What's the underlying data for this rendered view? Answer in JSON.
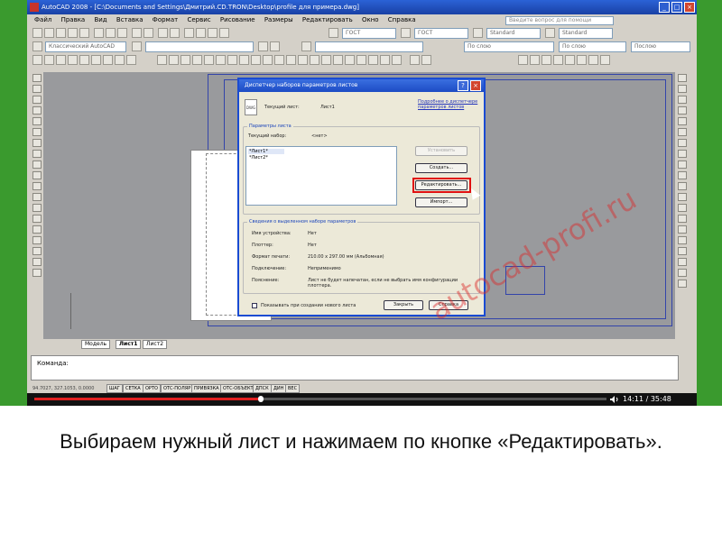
{
  "window": {
    "title": "AutoCAD 2008 - [C:\\Documents and Settings\\Дмитрий.CD.TRON\\Desktop\\profile для примера.dwg]",
    "help_placeholder": "Введите вопрос для помощи"
  },
  "menu": [
    "Файл",
    "Правка",
    "Вид",
    "Вставка",
    "Формат",
    "Сервис",
    "Рисование",
    "Размеры",
    "Редактировать",
    "Окно",
    "Справка"
  ],
  "toolbar": {
    "layer_select": "Классический AutoCAD",
    "style1": "ГОСТ",
    "style2": "ГОСТ",
    "style3": "Standard",
    "style4": "Standard",
    "linetype": "По слою",
    "lineweight": "По слою",
    "plotstyle": "Послою"
  },
  "tabs": [
    "Модель",
    "Лист1",
    "Лист2"
  ],
  "command": {
    "prompt": "Команда:"
  },
  "status": {
    "coords": "94.7027, 327.1053, 0.0000",
    "buttons": [
      "ШАГ",
      "СЕТКА",
      "ОРТО",
      "ОТС-ПОЛЯР",
      "ПРИВЯЗКА",
      "ОТС-ОБЪЕКТ",
      "ДПСК",
      "ДИН",
      "ВЕС"
    ]
  },
  "player": {
    "time": "14:11 / 35:48",
    "progress": 0.396
  },
  "dialog": {
    "title": "Диспетчер наборов параметров листов",
    "current_sheet_label": "Текущий лист:",
    "current_sheet_value": "Лист1",
    "help_link": "Подробнее о диспетчере параметров листов",
    "params_group": "Параметры листа",
    "current_set_label": "Текущий набор:",
    "current_set_value": "<нет>",
    "list_items": [
      "*Лист1*",
      "*Лист2*"
    ],
    "btn_set": "Установить",
    "btn_create": "Создать...",
    "btn_edit": "Редактировать...",
    "btn_import": "Импорт...",
    "details_group": "Сведения о выделенном наборе параметров",
    "details": [
      {
        "label": "Имя устройства:",
        "value": "Нет"
      },
      {
        "label": "Плоттер:",
        "value": "Нет"
      },
      {
        "label": "Формат печати:",
        "value": "210.00 x 297.00 мм (Альбомная)"
      },
      {
        "label": "Подключение:",
        "value": "Неприменимо"
      },
      {
        "label": "Пояснение:",
        "value": "Лист не будет напечатан, если не выбрать имя конфигурации плоттера."
      }
    ],
    "checkbox_label": "Показывать при создании нового листа",
    "btn_close": "Закрыть",
    "btn_help": "Справка"
  },
  "watermark": "autocad-profi.ru",
  "caption": "Выбираем нужный лист и нажимаем по кнопке «Редактировать».",
  "colors": {
    "frame": "#3a9a2e",
    "highlight": "#e01010",
    "link": "#2233bb",
    "watermark": "#dc2828"
  }
}
